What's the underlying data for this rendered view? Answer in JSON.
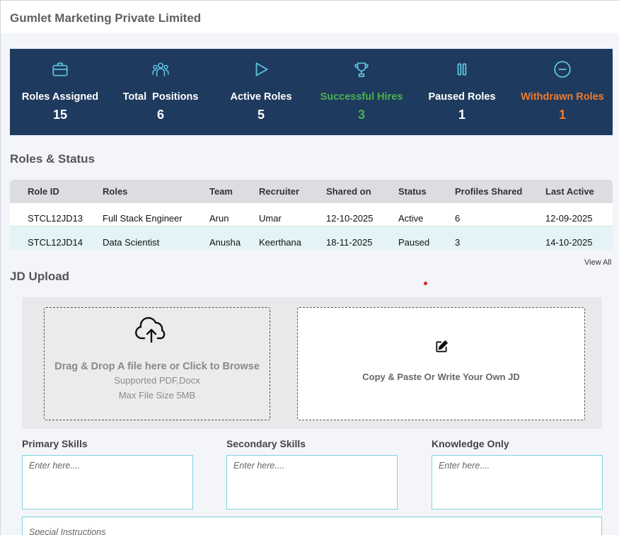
{
  "company": "Gumlet Marketing Private Limited",
  "stats": [
    {
      "label": "Roles Assigned",
      "value": "15",
      "icon": "briefcase-icon"
    },
    {
      "label": "Total  Positions",
      "value": "6",
      "icon": "people-icon"
    },
    {
      "label": "Active Roles",
      "value": "5",
      "icon": "play-icon"
    },
    {
      "label": "Successful Hires",
      "value": "3",
      "icon": "trophy-icon"
    },
    {
      "label": "Paused Roles",
      "value": "1",
      "icon": "pause-icon"
    },
    {
      "label": "Withdrawn Roles",
      "value": "1",
      "icon": "minus-circle-icon"
    }
  ],
  "colors": {
    "header_bg": "#1f3a5f",
    "icon": "#5ec8e0",
    "success": "#4caf50",
    "withdrawn": "#f07b2c"
  },
  "roles_section": {
    "title": "Roles & Status",
    "columns": [
      "Role ID",
      "Roles",
      "Team",
      "Recruiter",
      "Shared on",
      "Status",
      "Profiles Shared",
      "Last Active"
    ],
    "rows": [
      [
        "STCL12JD13",
        "Full Stack Engineer",
        "Arun",
        "Umar",
        "12-10-2025",
        "Active",
        "6",
        "12-09-2025"
      ],
      [
        "STCL12JD14",
        "Data Scientist",
        "Anusha",
        "Keerthana",
        "18-11-2025",
        "Paused",
        "3",
        "14-10-2025"
      ]
    ],
    "view_all": "View All"
  },
  "jd_upload": {
    "title": "JD Upload",
    "drop_title": "Drag & Drop A file here or Click to Browse",
    "supported": "Supported PDF,Docx",
    "max_size": "Max File Size 5MB",
    "write_label": "Copy & Paste Or Write Your Own JD"
  },
  "skills": {
    "primary_label": "Primary Skills",
    "secondary_label": "Secondary Skills",
    "knowledge_label": "Knowledge Only",
    "placeholder": "Enter here....",
    "special_placeholder": "Special Instructions"
  }
}
